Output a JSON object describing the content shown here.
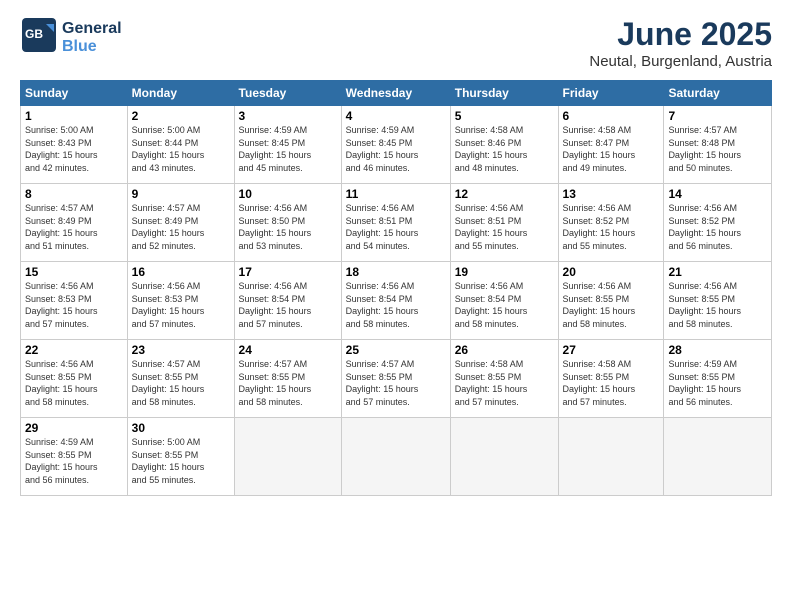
{
  "logo": {
    "line1": "General",
    "line2": "Blue"
  },
  "title": "June 2025",
  "location": "Neutal, Burgenland, Austria",
  "header_days": [
    "Sunday",
    "Monday",
    "Tuesday",
    "Wednesday",
    "Thursday",
    "Friday",
    "Saturday"
  ],
  "weeks": [
    [
      {
        "day": "1",
        "sunrise": "5:00 AM",
        "sunset": "8:43 PM",
        "daylight": "15 hours and 42 minutes."
      },
      {
        "day": "2",
        "sunrise": "5:00 AM",
        "sunset": "8:44 PM",
        "daylight": "15 hours and 43 minutes."
      },
      {
        "day": "3",
        "sunrise": "4:59 AM",
        "sunset": "8:45 PM",
        "daylight": "15 hours and 45 minutes."
      },
      {
        "day": "4",
        "sunrise": "4:59 AM",
        "sunset": "8:45 PM",
        "daylight": "15 hours and 46 minutes."
      },
      {
        "day": "5",
        "sunrise": "4:58 AM",
        "sunset": "8:46 PM",
        "daylight": "15 hours and 48 minutes."
      },
      {
        "day": "6",
        "sunrise": "4:58 AM",
        "sunset": "8:47 PM",
        "daylight": "15 hours and 49 minutes."
      },
      {
        "day": "7",
        "sunrise": "4:57 AM",
        "sunset": "8:48 PM",
        "daylight": "15 hours and 50 minutes."
      }
    ],
    [
      {
        "day": "8",
        "sunrise": "4:57 AM",
        "sunset": "8:49 PM",
        "daylight": "15 hours and 51 minutes."
      },
      {
        "day": "9",
        "sunrise": "4:57 AM",
        "sunset": "8:49 PM",
        "daylight": "15 hours and 52 minutes."
      },
      {
        "day": "10",
        "sunrise": "4:56 AM",
        "sunset": "8:50 PM",
        "daylight": "15 hours and 53 minutes."
      },
      {
        "day": "11",
        "sunrise": "4:56 AM",
        "sunset": "8:51 PM",
        "daylight": "15 hours and 54 minutes."
      },
      {
        "day": "12",
        "sunrise": "4:56 AM",
        "sunset": "8:51 PM",
        "daylight": "15 hours and 55 minutes."
      },
      {
        "day": "13",
        "sunrise": "4:56 AM",
        "sunset": "8:52 PM",
        "daylight": "15 hours and 55 minutes."
      },
      {
        "day": "14",
        "sunrise": "4:56 AM",
        "sunset": "8:52 PM",
        "daylight": "15 hours and 56 minutes."
      }
    ],
    [
      {
        "day": "15",
        "sunrise": "4:56 AM",
        "sunset": "8:53 PM",
        "daylight": "15 hours and 57 minutes."
      },
      {
        "day": "16",
        "sunrise": "4:56 AM",
        "sunset": "8:53 PM",
        "daylight": "15 hours and 57 minutes."
      },
      {
        "day": "17",
        "sunrise": "4:56 AM",
        "sunset": "8:54 PM",
        "daylight": "15 hours and 57 minutes."
      },
      {
        "day": "18",
        "sunrise": "4:56 AM",
        "sunset": "8:54 PM",
        "daylight": "15 hours and 58 minutes."
      },
      {
        "day": "19",
        "sunrise": "4:56 AM",
        "sunset": "8:54 PM",
        "daylight": "15 hours and 58 minutes."
      },
      {
        "day": "20",
        "sunrise": "4:56 AM",
        "sunset": "8:55 PM",
        "daylight": "15 hours and 58 minutes."
      },
      {
        "day": "21",
        "sunrise": "4:56 AM",
        "sunset": "8:55 PM",
        "daylight": "15 hours and 58 minutes."
      }
    ],
    [
      {
        "day": "22",
        "sunrise": "4:56 AM",
        "sunset": "8:55 PM",
        "daylight": "15 hours and 58 minutes."
      },
      {
        "day": "23",
        "sunrise": "4:57 AM",
        "sunset": "8:55 PM",
        "daylight": "15 hours and 58 minutes."
      },
      {
        "day": "24",
        "sunrise": "4:57 AM",
        "sunset": "8:55 PM",
        "daylight": "15 hours and 58 minutes."
      },
      {
        "day": "25",
        "sunrise": "4:57 AM",
        "sunset": "8:55 PM",
        "daylight": "15 hours and 57 minutes."
      },
      {
        "day": "26",
        "sunrise": "4:58 AM",
        "sunset": "8:55 PM",
        "daylight": "15 hours and 57 minutes."
      },
      {
        "day": "27",
        "sunrise": "4:58 AM",
        "sunset": "8:55 PM",
        "daylight": "15 hours and 57 minutes."
      },
      {
        "day": "28",
        "sunrise": "4:59 AM",
        "sunset": "8:55 PM",
        "daylight": "15 hours and 56 minutes."
      }
    ],
    [
      {
        "day": "29",
        "sunrise": "4:59 AM",
        "sunset": "8:55 PM",
        "daylight": "15 hours and 56 minutes."
      },
      {
        "day": "30",
        "sunrise": "5:00 AM",
        "sunset": "8:55 PM",
        "daylight": "15 hours and 55 minutes."
      },
      null,
      null,
      null,
      null,
      null
    ]
  ]
}
